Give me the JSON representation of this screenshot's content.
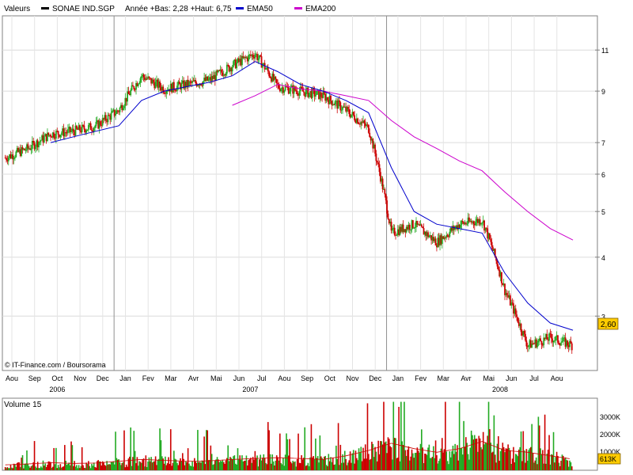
{
  "header": {
    "label": "Valeurs",
    "instrument": "SONAE IND.SGP",
    "range_text": "Année +Bas: 2,28 +Haut: 6,75",
    "ema50": "EMA50",
    "ema200": "EMA200",
    "colors": {
      "instrument": "#000000",
      "ema50": "#0000cc",
      "ema200": "#cc00cc"
    }
  },
  "credit": "© IT-Finance.com / Boursorama",
  "last_price": "2,60",
  "volume": {
    "title": "Volume 15",
    "axis_labels": [
      "3000K",
      "2000K",
      "1000K"
    ],
    "last_label": "613K"
  },
  "chart_data": {
    "type": "candlestick",
    "price_axis": {
      "scale": "log",
      "ticks": [
        3,
        4,
        5,
        6,
        7,
        9,
        11
      ],
      "range": [
        2.3,
        13.0
      ]
    },
    "months": [
      "Aou",
      "Sep",
      "Oct",
      "Nov",
      "Dec",
      "Jan",
      "Fev",
      "Mar",
      "Avr",
      "Mai",
      "Jun",
      "Jul",
      "Aou",
      "Sep",
      "Oct",
      "Nov",
      "Dec",
      "Jan",
      "Fev",
      "Mar",
      "Avr",
      "Mai",
      "Jun",
      "Jul",
      "Aou"
    ],
    "years": [
      "2006",
      "2007",
      "2008"
    ],
    "close_by_month": [
      6.5,
      6.8,
      7.3,
      7.4,
      7.6,
      8.2,
      9.7,
      9.1,
      9.3,
      9.5,
      10.2,
      10.8,
      9.2,
      9.0,
      8.8,
      8.2,
      7.5,
      4.5,
      4.7,
      4.3,
      4.7,
      4.8,
      3.4,
      2.6,
      2.7,
      2.6
    ],
    "ema50_by_month": [
      null,
      null,
      7.0,
      7.2,
      7.4,
      7.6,
      8.6,
      9.0,
      9.2,
      9.4,
      9.7,
      10.4,
      9.9,
      9.3,
      9.0,
      8.6,
      8.1,
      6.2,
      5.0,
      4.7,
      4.6,
      4.5,
      3.7,
      3.2,
      2.9,
      2.8
    ],
    "ema200_by_month": [
      null,
      null,
      null,
      null,
      null,
      null,
      null,
      null,
      null,
      null,
      8.4,
      8.8,
      9.3,
      9.1,
      9.0,
      8.8,
      8.6,
      7.8,
      7.2,
      6.8,
      6.4,
      6.1,
      5.5,
      5.0,
      4.6,
      4.35
    ],
    "volume_axis_k": [
      0,
      4000
    ],
    "volume_by_month_k": [
      300,
      350,
      420,
      380,
      400,
      500,
      600,
      550,
      500,
      520,
      600,
      650,
      700,
      650,
      600,
      800,
      1100,
      1500,
      1200,
      1000,
      1200,
      1600,
      1100,
      1000,
      800,
      613
    ]
  }
}
